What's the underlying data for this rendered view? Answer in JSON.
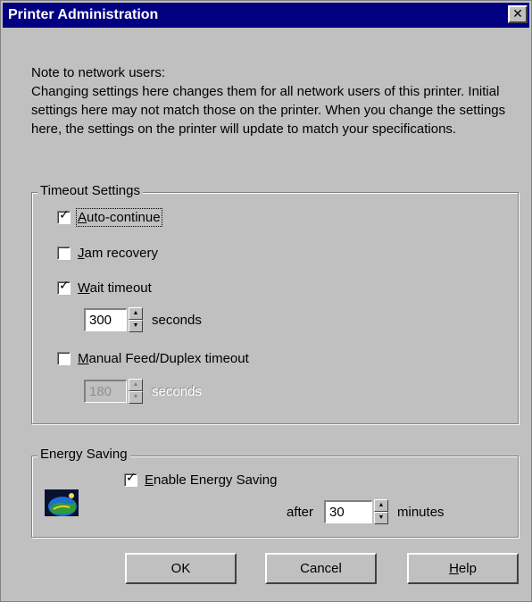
{
  "window": {
    "title": "Printer Administration",
    "close_glyph": "✕"
  },
  "note": {
    "heading": "Note to network users:",
    "body": "Changing settings here changes them for all network users of this printer.  Initial settings here may not match those on the printer.  When you change the settings here, the settings on the printer will update to match your specifications."
  },
  "timeout": {
    "group_label": "Timeout Settings",
    "auto_continue": {
      "prefix": "",
      "accel": "A",
      "rest": "uto-continue",
      "checked": true,
      "focused": true
    },
    "jam_recovery": {
      "prefix": "",
      "accel": "J",
      "rest": "am recovery",
      "checked": false
    },
    "wait_timeout": {
      "prefix": "",
      "accel": "W",
      "rest": "ait timeout",
      "checked": true
    },
    "wait_value": "300",
    "wait_unit": "seconds",
    "manual_feed": {
      "prefix": "",
      "accel": "M",
      "rest": "anual Feed/Duplex timeout",
      "checked": false
    },
    "manual_value": "180",
    "manual_unit": "seconds"
  },
  "energy": {
    "group_label": "Energy Saving",
    "icon": "energy-star-icon",
    "enable": {
      "prefix": "",
      "accel": "E",
      "rest": "nable Energy Saving",
      "checked": true
    },
    "after_label": "after",
    "value": "30",
    "unit": "minutes"
  },
  "buttons": {
    "ok": {
      "prefix": "OK",
      "accel": "",
      "rest": ""
    },
    "cancel": {
      "prefix": "Cancel",
      "accel": "",
      "rest": ""
    },
    "help": {
      "prefix": "",
      "accel": "H",
      "rest": "elp"
    }
  },
  "colors": {
    "titlebar": "#000080",
    "face": "#c0c0c0"
  }
}
